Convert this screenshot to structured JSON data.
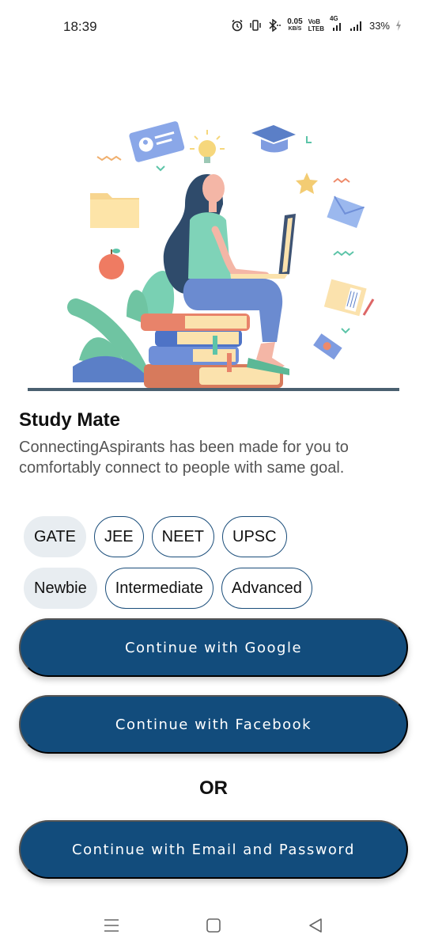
{
  "status_bar": {
    "time": "18:39",
    "speed_value": "0.05",
    "speed_unit": "KB/S",
    "volte_top": "VoB",
    "volte_bottom": "LTEB",
    "network": "4G",
    "battery": "33%",
    "icons": [
      "alarm-icon",
      "vibrate-icon",
      "bluetooth-icon",
      "signal-icon",
      "signal-icon",
      "charging-icon"
    ]
  },
  "intro": {
    "title": "Study Mate",
    "description": "ConnectingAspirants has been made for you to comfortably connect to people with same goal."
  },
  "exams": {
    "options": [
      "GATE",
      "JEE",
      "NEET",
      "UPSC"
    ],
    "selected": "GATE"
  },
  "levels": {
    "options": [
      "Newbie",
      "Intermediate",
      "Advanced"
    ],
    "selected": "Newbie"
  },
  "auth": {
    "google_label": "Continue with Google",
    "facebook_label": "Continue with Facebook",
    "or_label": "OR",
    "email_label": "Continue with Email and Password"
  },
  "colors": {
    "primary": "#124c7c",
    "chip_selected_bg": "#e8edf1",
    "chip_border": "#1a4d7a"
  },
  "nav": {
    "icons": [
      "menu-icon",
      "home-square-icon",
      "back-triangle-icon"
    ]
  }
}
